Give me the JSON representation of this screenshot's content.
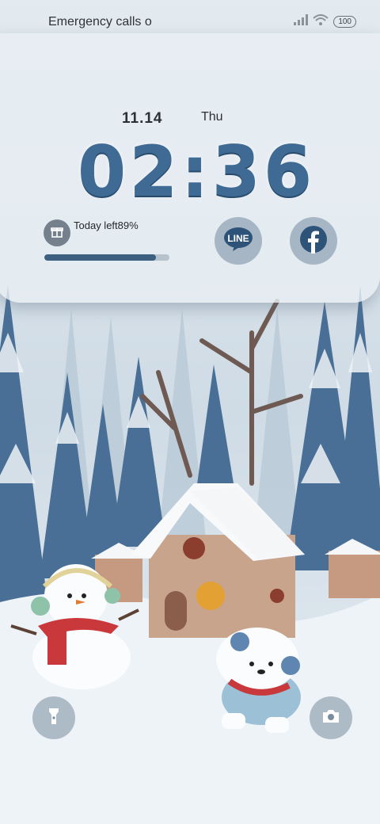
{
  "status_bar": {
    "carrier_text": "Emergency calls o",
    "battery": "100"
  },
  "lock_card": {
    "date": "11.14",
    "weekday": "Thu",
    "time": "02:36",
    "today_label": "Today left89%",
    "progress_fraction": 0.89,
    "line_label": "LINE"
  },
  "colors": {
    "time": "#3f6a93",
    "accent": "#3d5f80"
  },
  "icons": [
    "signal-icon",
    "wifi-icon",
    "gift-icon",
    "line-icon",
    "facebook-icon",
    "flashlight-icon",
    "camera-icon"
  ]
}
